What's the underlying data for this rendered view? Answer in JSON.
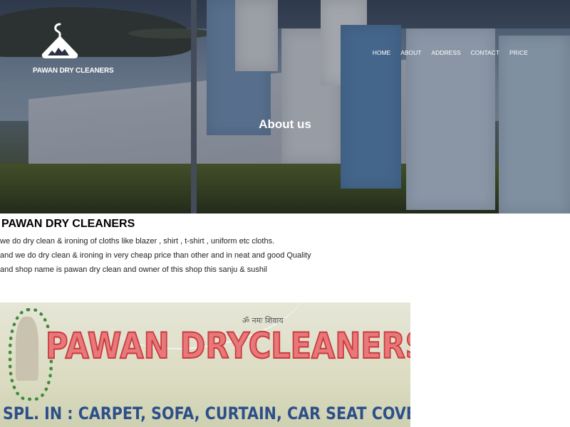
{
  "brand": {
    "name": "PAWAN DRY CLEANERS",
    "logo_icon": "hanger-icon"
  },
  "nav": {
    "items": [
      {
        "label": "HOME"
      },
      {
        "label": "ABOUT"
      },
      {
        "label": "ADDRESS"
      },
      {
        "label": "CONTACT"
      },
      {
        "label": "PRICE"
      }
    ]
  },
  "hero": {
    "title": "About us"
  },
  "about": {
    "heading": "PAWAN DRY CLEANERS",
    "lines": [
      "we do dry clean & ironing of cloths like blazer , shirt , t-shirt , uniform etc cloths.",
      "and we do dry clean & ironing in very cheap price than other and in neat and good Quality",
      "and shop name is pawan dry clean and owner of this shop this sanju & sushil"
    ]
  },
  "sign_photo": {
    "invocation": "ॐ नमः शिवाय",
    "title": "PAWAN DRYCLEANERS",
    "subtitle": "SPL. IN : CARPET, SOFA, CURTAIN, CAR SEAT COVER, SUIT, SAREE ETC."
  },
  "colors": {
    "hero_overlay": "#1e2534",
    "sign_red": "#e8787a",
    "sign_blue": "#2d4f8a",
    "text_dark": "#111111",
    "nav_text": "#ffffff"
  }
}
